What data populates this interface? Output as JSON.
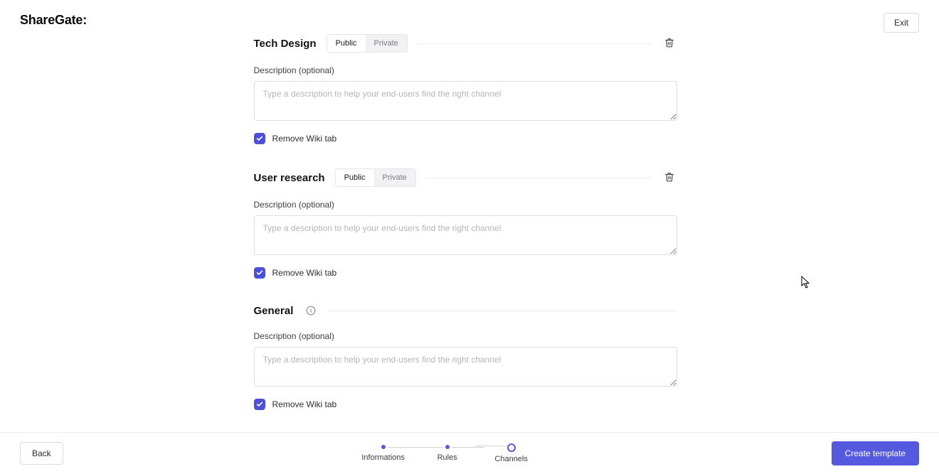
{
  "brand": "ShareGate",
  "brand_suffix": ":",
  "exit_label": "Exit",
  "description_label": "Description (optional)",
  "description_placeholder": "Type a description to help your end-users find the right channel",
  "remove_wiki_label": "Remove Wiki tab",
  "privacy": {
    "public": "Public",
    "private": "Private"
  },
  "channels": [
    {
      "name": "Tech Design",
      "has_privacy_toggle": true,
      "privacy_selected": "Public",
      "deletable": true,
      "info": false,
      "remove_wiki_checked": true,
      "description": ""
    },
    {
      "name": "User research",
      "has_privacy_toggle": true,
      "privacy_selected": "Public",
      "deletable": true,
      "info": false,
      "remove_wiki_checked": true,
      "description": ""
    },
    {
      "name": "General",
      "has_privacy_toggle": false,
      "privacy_selected": null,
      "deletable": false,
      "info": true,
      "remove_wiki_checked": true,
      "description": ""
    }
  ],
  "footer": {
    "back": "Back",
    "primary": "Create template",
    "steps": [
      {
        "label": "Informations",
        "state": "done"
      },
      {
        "label": "Rules",
        "state": "done"
      },
      {
        "label": "Channels",
        "state": "current"
      }
    ]
  }
}
